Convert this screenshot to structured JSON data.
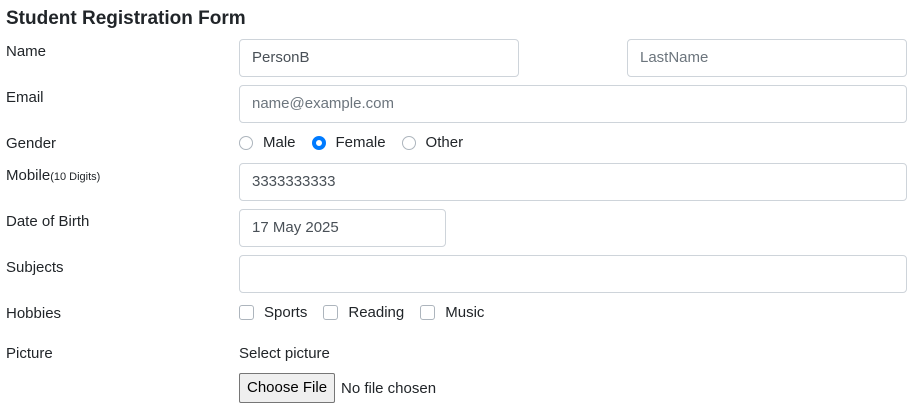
{
  "form": {
    "title": "Student Registration Form",
    "name": {
      "label": "Name",
      "first_value": "PersonB",
      "last_placeholder": "LastName"
    },
    "email": {
      "label": "Email",
      "placeholder": "name@example.com"
    },
    "gender": {
      "label": "Gender",
      "options": [
        "Male",
        "Female",
        "Other"
      ],
      "selected": "Female"
    },
    "mobile": {
      "label": "Mobile",
      "label_hint": "(10 Digits)",
      "value": "3333333333"
    },
    "dob": {
      "label": "Date of Birth",
      "value": "17 May 2025"
    },
    "subjects": {
      "label": "Subjects",
      "value": ""
    },
    "hobbies": {
      "label": "Hobbies",
      "options": [
        "Sports",
        "Reading",
        "Music"
      ]
    },
    "picture": {
      "label": "Picture",
      "select_label": "Select picture",
      "button_label": "Choose File",
      "status": "No file chosen"
    }
  },
  "colors": {
    "accent": "#007bff",
    "border": "#ced4da",
    "text": "#212529"
  }
}
